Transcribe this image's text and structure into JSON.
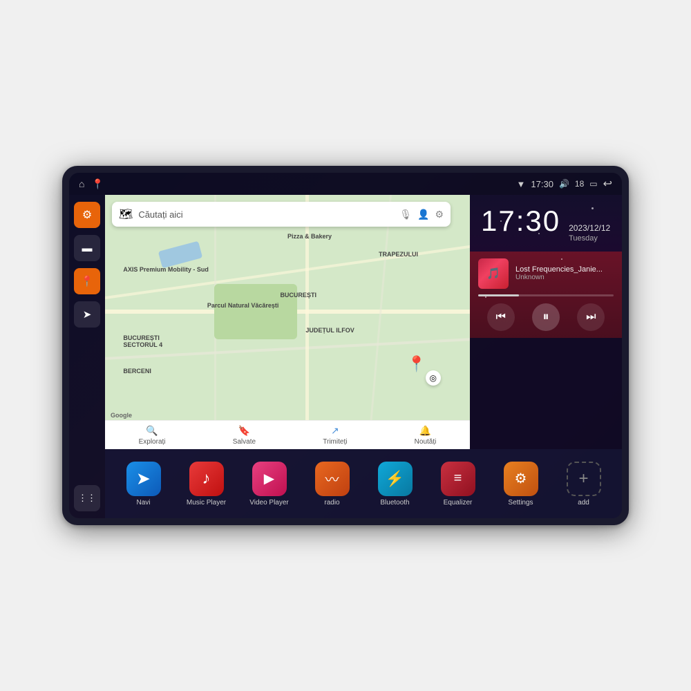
{
  "device": {
    "status_bar": {
      "left_icons": [
        "home",
        "map-pin"
      ],
      "wifi_signal": "▼",
      "time": "17:30",
      "volume_icon": "🔊",
      "battery_level": "18",
      "battery_icon": "🔋",
      "back_icon": "↩"
    },
    "sidebar": {
      "items": [
        {
          "name": "settings",
          "icon": "⚙",
          "style": "orange"
        },
        {
          "name": "files",
          "icon": "📁",
          "style": "dark"
        },
        {
          "name": "map",
          "icon": "📍",
          "style": "orange"
        },
        {
          "name": "navigation",
          "icon": "➤",
          "style": "dark"
        },
        {
          "name": "apps",
          "icon": "⋮⋮",
          "style": "dark"
        }
      ]
    },
    "map": {
      "search_placeholder": "Căutați aici",
      "places": [
        "AXIS Premium Mobility - Sud",
        "Pizza & Bakery",
        "Parcul Natural Văcărești",
        "BUCUREȘTI SECTORUL 4",
        "BUCUREȘTI",
        "JUDEȚUL ILFOV",
        "BERCENI",
        "TRAPEZULUI"
      ],
      "tabs": [
        {
          "icon": "🔍",
          "label": "Explorați"
        },
        {
          "icon": "🔖",
          "label": "Salvate"
        },
        {
          "icon": "↗",
          "label": "Trimiteți"
        },
        {
          "icon": "🔔",
          "label": "Noutăți"
        }
      ]
    },
    "clock": {
      "time": "17:30",
      "date": "2023/12/12",
      "day": "Tuesday"
    },
    "music": {
      "title": "Lost Frequencies_Janie...",
      "artist": "Unknown",
      "progress": 30
    },
    "apps": [
      {
        "name": "Navi",
        "icon": "➤",
        "style": "blue-grad"
      },
      {
        "name": "Music Player",
        "icon": "♪",
        "style": "red-grad"
      },
      {
        "name": "Video Player",
        "icon": "▶",
        "style": "pink-grad"
      },
      {
        "name": "radio",
        "icon": "〰",
        "style": "orange-grad"
      },
      {
        "name": "Bluetooth",
        "icon": "⚡",
        "style": "teal-blue"
      },
      {
        "name": "Equalizer",
        "icon": "≡",
        "style": "dark-red"
      },
      {
        "name": "Settings",
        "icon": "⚙",
        "style": "orange2"
      },
      {
        "name": "add",
        "icon": "+",
        "style": "gray-border"
      }
    ]
  }
}
